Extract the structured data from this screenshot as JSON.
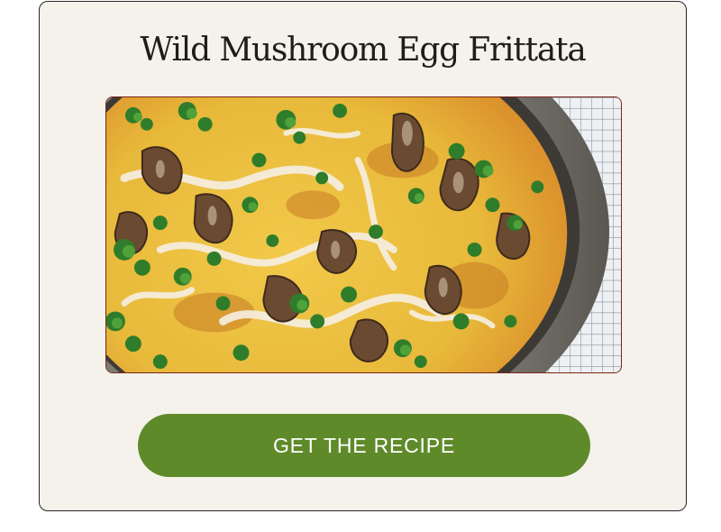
{
  "recipe_card": {
    "title": "Wild Mushroom Egg Frittata",
    "image_description_icon": "frittata-photo",
    "cta_label": "GET THE RECIPE",
    "colors": {
      "card_background": "#f5f2ec",
      "card_border": "#2a2623",
      "image_border": "#7a2418",
      "button_background": "#5f8a2a",
      "button_text": "#ffffff",
      "title_text": "#1f1c1a"
    }
  }
}
